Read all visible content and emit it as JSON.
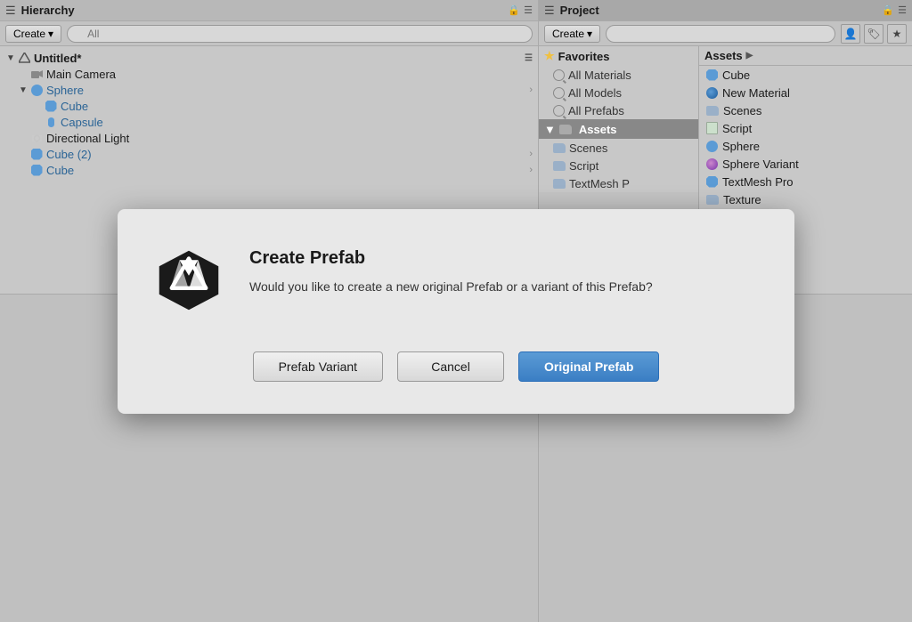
{
  "hierarchy_panel": {
    "title": "Hierarchy",
    "create_label": "Create",
    "search_placeholder": "All",
    "tree": [
      {
        "id": "untitled",
        "label": "Untitled*",
        "type": "root",
        "indent": 0,
        "has_arrow": true,
        "arrow_down": true
      },
      {
        "id": "main-camera",
        "label": "Main Camera",
        "type": "camera",
        "indent": 1,
        "has_arrow": false
      },
      {
        "id": "sphere",
        "label": "Sphere",
        "type": "sphere",
        "indent": 1,
        "has_arrow": true,
        "arrow_down": true,
        "text_color": "blue"
      },
      {
        "id": "cube1",
        "label": "Cube",
        "type": "cube",
        "indent": 2,
        "has_arrow": false,
        "text_color": "blue"
      },
      {
        "id": "capsule",
        "label": "Capsule",
        "type": "cube",
        "indent": 2,
        "has_arrow": false,
        "text_color": "blue"
      },
      {
        "id": "directional-light",
        "label": "Directional Light",
        "type": "light",
        "indent": 1,
        "has_arrow": false
      },
      {
        "id": "cube2",
        "label": "Cube (2)",
        "type": "cube",
        "indent": 1,
        "has_arrow": false,
        "text_color": "blue",
        "has_chevron": true
      },
      {
        "id": "cube3",
        "label": "Cube",
        "type": "cube",
        "indent": 1,
        "has_arrow": false,
        "text_color": "blue",
        "has_chevron": true
      }
    ]
  },
  "project_panel": {
    "title": "Project",
    "create_label": "Create",
    "search_placeholder": "",
    "favorites": {
      "label": "Favorites",
      "items": [
        {
          "label": "All Materials",
          "type": "search"
        },
        {
          "label": "All Models",
          "type": "search"
        },
        {
          "label": "All Prefabs",
          "type": "search"
        }
      ]
    },
    "assets_folder": {
      "label": "Assets",
      "items": [
        {
          "label": "Scenes",
          "type": "folder"
        },
        {
          "label": "Script",
          "type": "folder"
        },
        {
          "label": "TextMesh P",
          "type": "folder"
        }
      ]
    },
    "assets_list": {
      "label": "Assets",
      "chevron": "▶",
      "items": [
        {
          "label": "Cube",
          "type": "cube"
        },
        {
          "label": "New Material",
          "type": "material"
        },
        {
          "label": "Scenes",
          "type": "folder"
        },
        {
          "label": "Script",
          "type": "script"
        },
        {
          "label": "Sphere",
          "type": "sphere"
        },
        {
          "label": "Sphere Variant",
          "type": "variant"
        },
        {
          "label": "TextMesh Pro",
          "type": "textmesh"
        },
        {
          "label": "Texture",
          "type": "folder"
        }
      ]
    }
  },
  "modal": {
    "title": "Create Prefab",
    "description": "Would you like to create a new original Prefab or a variant of this Prefab?",
    "btn_variant_label": "Prefab Variant",
    "btn_cancel_label": "Cancel",
    "btn_original_label": "Original Prefab"
  }
}
